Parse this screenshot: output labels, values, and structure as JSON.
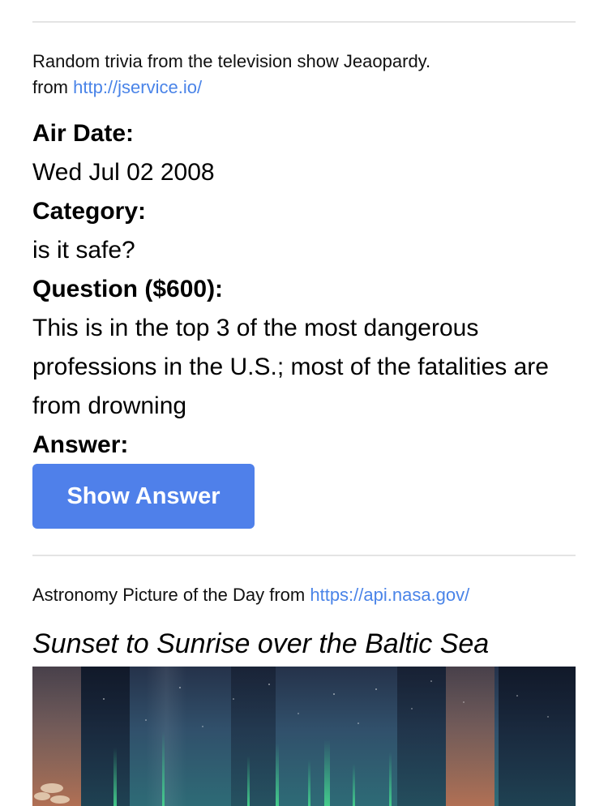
{
  "trivia": {
    "intro": "Random trivia from the television show Jeaopardy.",
    "source_prefix": "from",
    "source_link": "http://jservice.io/",
    "air_date_label": "Air Date:",
    "air_date": "Wed Jul 02 2008",
    "category_label": "Category:",
    "category": "is it safe?",
    "question_label": "Question ($600):",
    "question": "This is in the top 3 of the most dangerous professions in the U.S.; most of the fatalities are from drowning",
    "answer_label": "Answer:",
    "show_answer_button": "Show Answer"
  },
  "apod": {
    "source_text": "Astronomy Picture of the Day from",
    "source_link": "https://api.nasa.gov/",
    "title": "Sunset to Sunrise over the Baltic Sea"
  },
  "colors": {
    "link": "#4a84e8",
    "button": "#4f80ea",
    "divider": "#e4e4e4"
  }
}
